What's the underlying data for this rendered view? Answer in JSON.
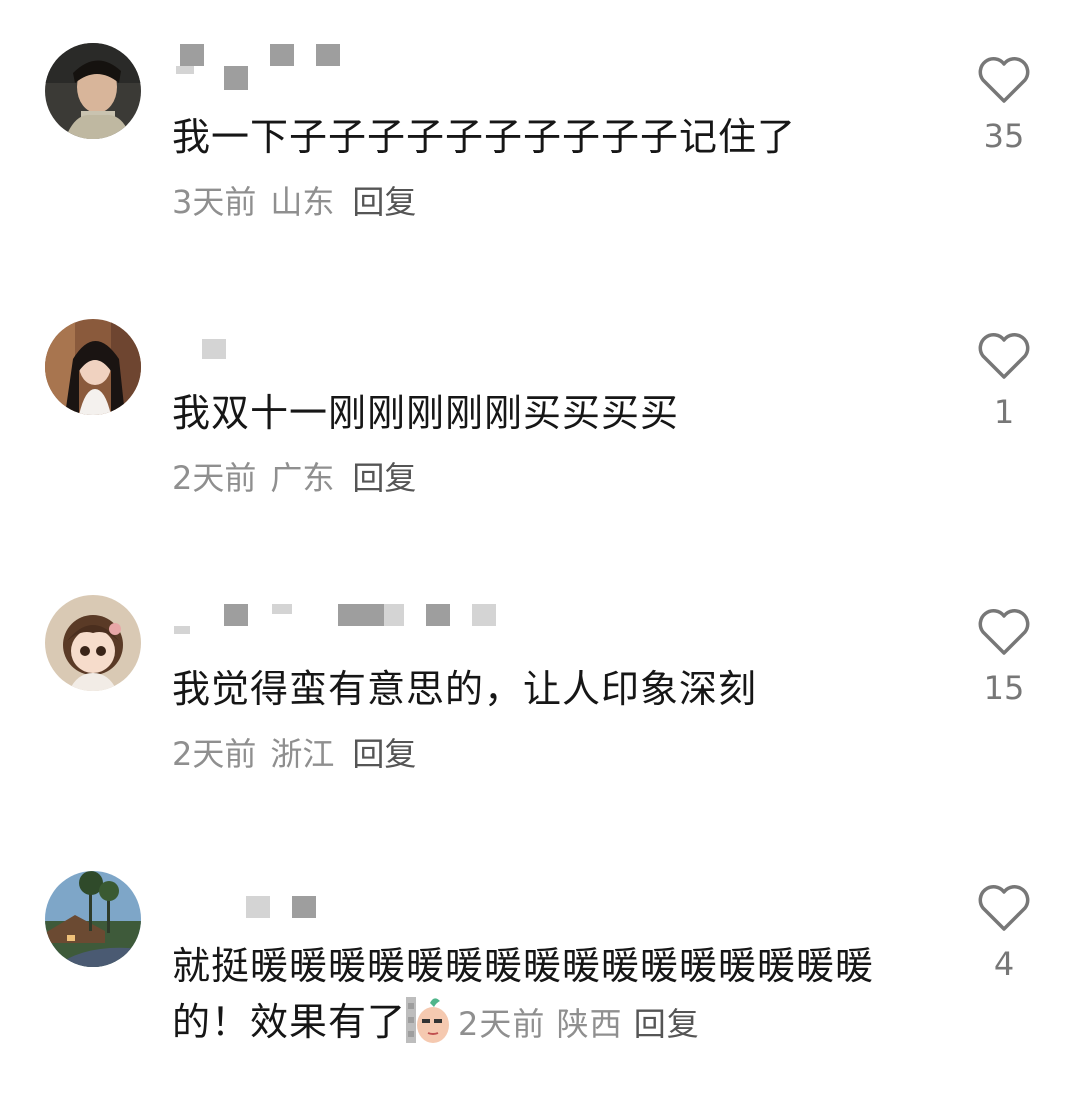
{
  "comments": [
    {
      "text": "我一下子子子子子子子子子子记住了",
      "time": "3天前",
      "location": "山东",
      "reply_label": "回复",
      "likes": "35"
    },
    {
      "text": "我双十一刚刚刚刚刚买买买买",
      "time": "2天前",
      "location": "广东",
      "reply_label": "回复",
      "likes": "1"
    },
    {
      "text": "我觉得蛮有意思的，让人印象深刻",
      "time": "2天前",
      "location": "浙江",
      "reply_label": "回复",
      "likes": "15"
    },
    {
      "text": "就挺暖暖暖暖暖暖暖暖暖暖暖暖暖暖暖暖的！效果有了",
      "time": "2天前",
      "location": "陕西",
      "reply_label": "回复",
      "likes": "4",
      "sticker_icon": "peeking-peanut-sticker"
    }
  ],
  "icons": {
    "like": "heart-outline-icon"
  },
  "colors": {
    "text": "#161616",
    "meta": "#8f8f8f",
    "icon": "#777777"
  }
}
